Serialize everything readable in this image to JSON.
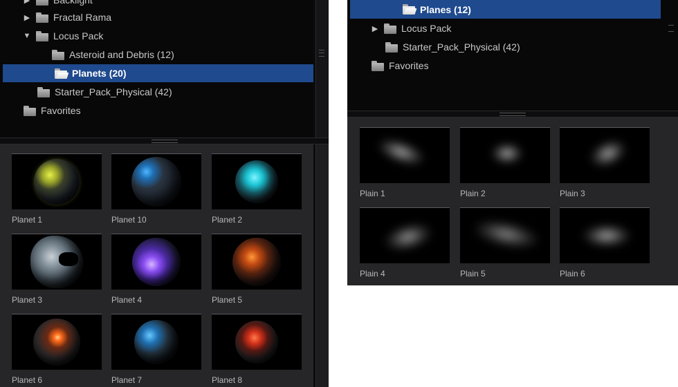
{
  "left_panel": {
    "tree": [
      {
        "label": "Backlight",
        "expanded": false
      },
      {
        "label": "Fractal Rama",
        "expanded": false
      },
      {
        "label": "Locus Pack",
        "expanded": true
      },
      {
        "label": "Asteroid and Debris (12)"
      },
      {
        "label": "Planets (20)",
        "selected": true
      },
      {
        "label": "Starter_Pack_Physical (42)"
      },
      {
        "label": "Favorites"
      }
    ],
    "thumbnails": [
      {
        "label": "Planet 1",
        "icon": "planet-yellow"
      },
      {
        "label": "Planet 10",
        "icon": "planet-blue"
      },
      {
        "label": "Planet 2",
        "icon": "planet-cyan"
      },
      {
        "label": "Planet 3",
        "icon": "planet-rocky"
      },
      {
        "label": "Planet 4",
        "icon": "planet-purple"
      },
      {
        "label": "Planet 5",
        "icon": "planet-lava"
      },
      {
        "label": "Planet 6",
        "icon": "planet-fire-core"
      },
      {
        "label": "Planet 7",
        "icon": "planet-ice"
      },
      {
        "label": "Planet 8",
        "icon": "planet-magma"
      }
    ]
  },
  "right_panel": {
    "tree": [
      {
        "label": "Planes (12)",
        "selected": true
      },
      {
        "label": "Locus Pack",
        "expanded": false
      },
      {
        "label": "Starter_Pack_Physical (42)"
      },
      {
        "label": "Favorites"
      }
    ],
    "thumbnails": [
      {
        "label": "Plain 1"
      },
      {
        "label": "Plain 2"
      },
      {
        "label": "Plain 3"
      },
      {
        "label": "Plain 4"
      },
      {
        "label": "Plain 5"
      },
      {
        "label": "Plain 6"
      }
    ]
  },
  "colors": {
    "selection": "#1f4a8e",
    "panel_bg": "#080809",
    "grid_bg": "#262629",
    "text": "#c9c9c9"
  }
}
